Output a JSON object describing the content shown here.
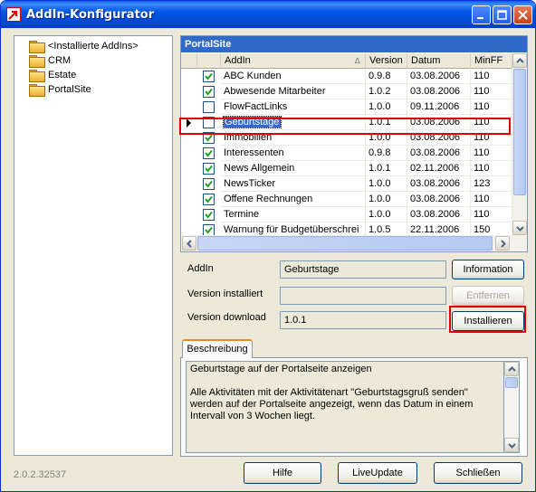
{
  "window": {
    "title": "AddIn-Konfigurator"
  },
  "tree": {
    "items": [
      {
        "label": "<Installierte AddIns>"
      },
      {
        "label": "CRM"
      },
      {
        "label": "Estate"
      },
      {
        "label": "PortalSite"
      }
    ]
  },
  "grid": {
    "title": "PortalSite",
    "columns": [
      "AddIn",
      "Version",
      "Datum",
      "MinFF"
    ],
    "rows": [
      {
        "checked": true,
        "name": "ABC Kunden",
        "version": "0.9.8",
        "datum": "03.08.2006",
        "minff": "110"
      },
      {
        "checked": true,
        "name": "Abwesende Mitarbeiter",
        "version": "1.0.2",
        "datum": "03.08.2006",
        "minff": "110"
      },
      {
        "checked": false,
        "name": "FlowFactLinks",
        "version": "1.0.0",
        "datum": "09.11.2006",
        "minff": "110"
      },
      {
        "checked": false,
        "name": "Geburtstage",
        "version": "1.0.1",
        "datum": "03.08.2006",
        "minff": "110",
        "selected": true
      },
      {
        "checked": true,
        "name": "Immobilien",
        "version": "1.0.0",
        "datum": "03.08.2006",
        "minff": "110"
      },
      {
        "checked": true,
        "name": "Interessenten",
        "version": "0.9.8",
        "datum": "03.08.2006",
        "minff": "110"
      },
      {
        "checked": true,
        "name": "News Allgemein",
        "version": "1.0.1",
        "datum": "02.11.2006",
        "minff": "110"
      },
      {
        "checked": true,
        "name": "NewsTicker",
        "version": "1.0.0",
        "datum": "03.08.2006",
        "minff": "123"
      },
      {
        "checked": true,
        "name": "Offene Rechnungen",
        "version": "1.0.0",
        "datum": "03.08.2006",
        "minff": "110"
      },
      {
        "checked": true,
        "name": "Termine",
        "version": "1.0.0",
        "datum": "03.08.2006",
        "minff": "110"
      },
      {
        "checked": true,
        "name": "Warnung für Budgetüberschrei",
        "version": "1.0.5",
        "datum": "22.11.2006",
        "minff": "150"
      }
    ]
  },
  "details": {
    "addin_label": "AddIn",
    "addin_value": "Geburtstage",
    "installed_label": "Version installiert",
    "installed_value": "",
    "download_label": "Version download",
    "download_value": "1.0.1",
    "information_button": "Information",
    "remove_button": "Entfernen",
    "install_button": "Installieren"
  },
  "description": {
    "tab_label": "Beschreibung",
    "line1": "Geburtstage auf der Portalseite anzeigen",
    "line2": "Alle Aktivitäten mit der Aktivitätenart \"Geburtstagsgruß senden\" werden auf der Portalseite angezeigt, wenn das Datum in einem Intervall von 3 Wochen liegt."
  },
  "footer": {
    "version": "2.0.2.32537",
    "help_button": "Hilfe",
    "liveupdate_button": "LiveUpdate",
    "close_button": "Schließen"
  }
}
